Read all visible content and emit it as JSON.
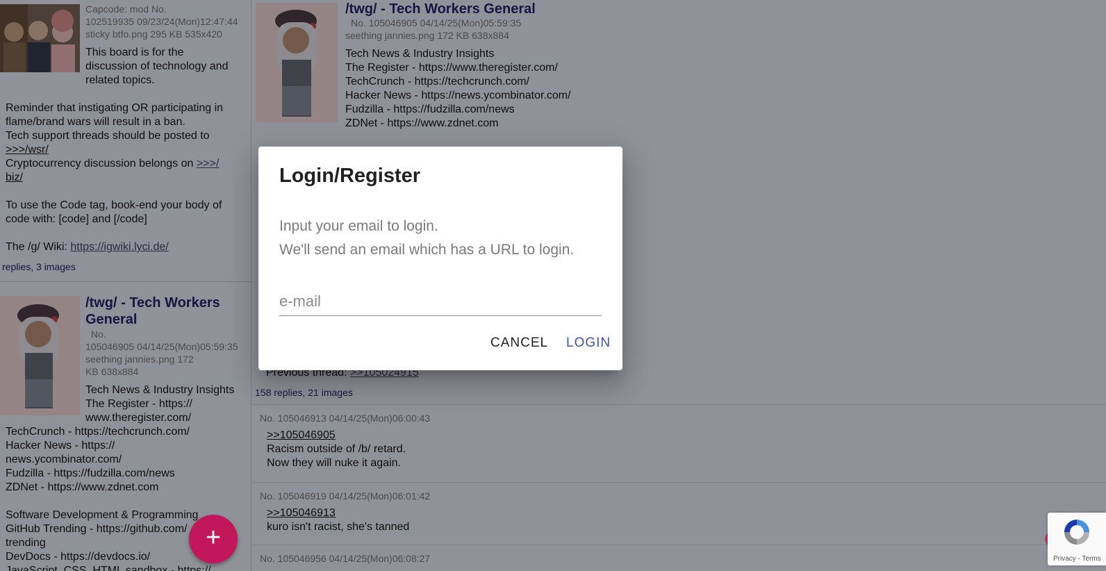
{
  "left": {
    "sticky": {
      "meta1": "Capcode: mod  No.",
      "meta2": "102519935 09/23/24(Mon)12:47:44",
      "meta3": "sticky btfo.png 295 KB 535x420",
      "intro1": "This board is for the",
      "intro2": "discussion of technology and",
      "intro3": "related topics.",
      "rule1": "Reminder that instigating OR participating in",
      "rule2": "flame/brand wars will result in a ban.",
      "rule3": "Tech support threads should be posted to",
      "rule3_link": ">>>/wsr/",
      "rule4": "Cryptocurrency discussion belongs on ",
      "rule4_link1": ">>>/",
      "rule4_link2": "biz/",
      "code1": "To use the Code tag, book-end your body of",
      "code2": "code with: [code] and [/code]",
      "wiki_label": "The /g/ Wiki: ",
      "wiki_link": "https://igwiki.lyci.de/",
      "count": "replies, 3 images"
    },
    "twg": {
      "subject1": "/twg/ - Tech Workers",
      "subject2": "General",
      "meta1": "No.",
      "meta2": "105046905 04/14/25(Mon)05:59:35",
      "meta3": "seething jannies.png 172",
      "meta4": "KB 638x884",
      "lines": [
        "Tech News & Industry Insights",
        "The Register - https://",
        "www.theregister.com/",
        "TechCrunch - https://techcrunch.com/",
        "Hacker News - https://",
        "news.ycombinator.com/",
        "Fudzilla - https://fudzilla.com/news",
        "ZDNet - https://www.zdnet.com",
        "",
        "Software Development & Programming",
        "GitHub Trending - https://github.com/",
        "trending",
        "DevDocs - https://devdocs.io/",
        "JavaScript, CSS, HTML sandbox - https://"
      ]
    }
  },
  "right": {
    "op": {
      "subject": "/twg/ - Tech Workers General",
      "meta1": "No. 105046905 04/14/25(Mon)05:59:35",
      "meta2": "seething jannies.png 172 KB 638x884",
      "lines": [
        "Tech News & Industry Insights",
        "The Register - https://www.theregister.com/",
        "TechCrunch - https://techcrunch.com/",
        "Hacker News - https://news.ycombinator.com/",
        "Fudzilla - https://fudzilla.com/news",
        "ZDNet - https://www.zdnet.com"
      ],
      "prev_label": "Previous thread: ",
      "prev_link": ">>105024915",
      "count": "158 replies, 21 images"
    },
    "replies": [
      {
        "meta": "No. 105046913 04/14/25(Mon)06:00:43",
        "quote": ">>105046905",
        "lines": [
          "Racism outside of /b/ retard.",
          "Now they will nuke it again."
        ]
      },
      {
        "meta": "No. 105046919 04/14/25(Mon)06:01:42",
        "quote": ">>105046913",
        "lines": [
          "kuro isn't racist, she's tanned"
        ]
      },
      {
        "meta": "No. 105046956 04/14/25(Mon)06:08:27",
        "quote": "",
        "lines": []
      }
    ]
  },
  "dialog": {
    "title": "Login/Register",
    "line1": "Input your email to login.",
    "line2": "We'll send an email which has a URL to login.",
    "placeholder": "e-mail",
    "cancel": "CANCEL",
    "login": "LOGIN"
  },
  "fab": {
    "label": "+"
  },
  "recaptcha": {
    "privacy": "Privacy",
    "sep": " - ",
    "terms": "Terms"
  }
}
